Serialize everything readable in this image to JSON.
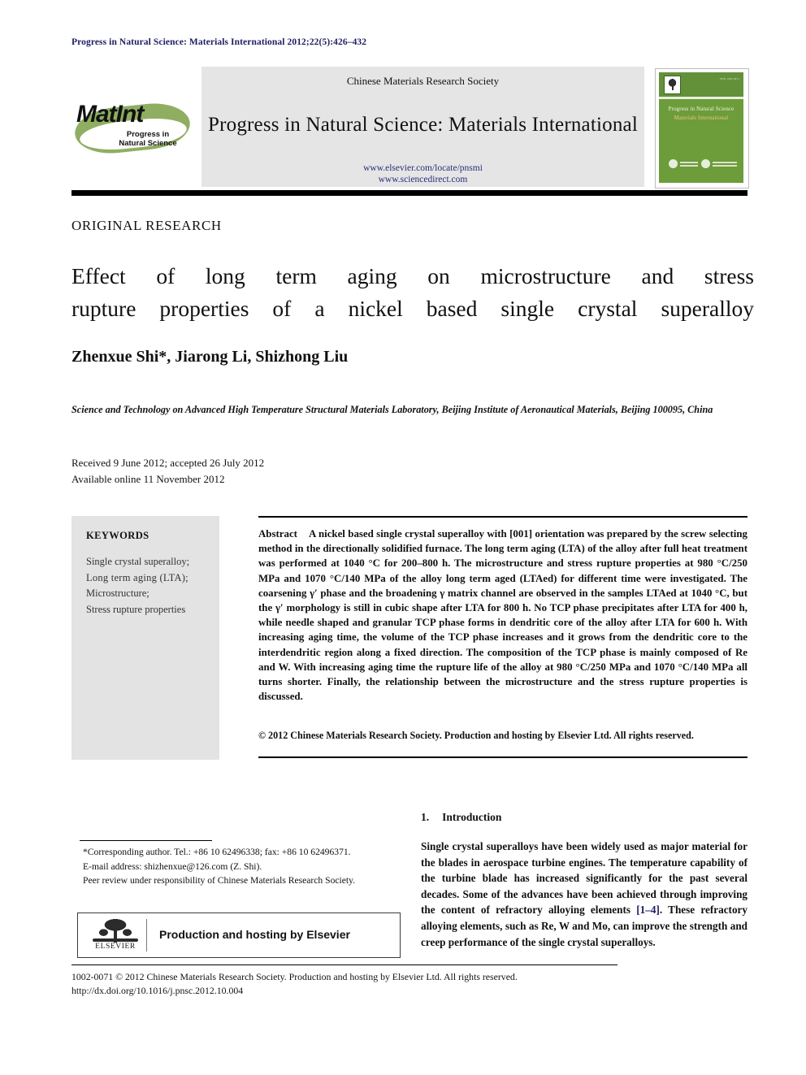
{
  "running_head": "Progress in Natural Science: Materials International 2012;22(5):426–432",
  "masthead": {
    "society": "Chinese Materials Research Society",
    "journal_title": "Progress in Natural Science: Materials International",
    "url_primary": "www.elsevier.com/locate/pnsmi",
    "url_secondary": "www.sciencedirect.com",
    "logo_wordmark": "MatInt",
    "logo_sub_line1": "Progress in",
    "logo_sub_line2": "Natural Science",
    "cover": {
      "issn": "ISSN 1002-0071",
      "title_line1": "Progress in Natural Science",
      "title_line2": "Materials International"
    }
  },
  "article_type": "ORIGINAL RESEARCH",
  "title_line1": "Effect of long term aging on microstructure and stress",
  "title_line2": "rupture properties of a nickel based single crystal superalloy",
  "authors": "Zhenxue Shi*, Jiarong Li, Shizhong Liu",
  "authors_plain": "Zhenxue Shi",
  "authors_rest": ", Jiarong Li, Shizhong Liu",
  "affiliation": "Science and Technology on Advanced High Temperature Structural Materials Laboratory, Beijing Institute of Aeronautical Materials, Beijing 100095, China",
  "dates": {
    "received": "Received 9 June 2012; accepted 26 July 2012",
    "available": "Available online 11 November 2012"
  },
  "keywords": {
    "heading": "KEYWORDS",
    "items": [
      "Single crystal superalloy;",
      "Long term aging (LTA);",
      "Microstructure;",
      "Stress rupture properties"
    ]
  },
  "abstract": {
    "label": "Abstract",
    "text": "A nickel based single crystal superalloy with [001] orientation was prepared by the screw selecting method in the directionally solidified furnace. The long term aging (LTA) of the alloy after full heat treatment was performed at 1040 °C for 200–800 h. The microstructure and stress rupture properties at 980 °C/250 MPa and 1070 °C/140 MPa of the alloy long term aged (LTAed) for different time were investigated. The coarsening γ′ phase and the broadening γ matrix channel are observed in the samples LTAed at 1040 °C, but the γ′ morphology is still in cubic shape after LTA for 800 h. No TCP phase precipitates after LTA for 400 h, while needle shaped and granular TCP phase forms in dendritic core of the alloy after LTA for 600 h. With increasing aging time, the volume of the TCP phase increases and it grows from the dendritic core to the interdendritic region along a fixed direction. The composition of the TCP phase is mainly composed of Re and W. With increasing aging time the rupture life of the alloy at 980 °C/250 MPa and 1070 °C/140 MPa all turns shorter. Finally, the relationship between the microstructure and the stress rupture properties is discussed.",
    "copyright": "© 2012 Chinese Materials Research Society. Production and hosting by Elsevier Ltd. All rights reserved."
  },
  "footnotes": {
    "corresponding": "*Corresponding author. Tel.: +86 10 62496338; fax: +86 10 62496371.",
    "email": "E-mail address: shizhenxue@126.com (Z. Shi).",
    "peer_review": "Peer review under responsibility of Chinese Materials Research Society."
  },
  "production_box": {
    "logo_name": "ELSEVIER",
    "text": "Production and hosting by Elsevier"
  },
  "introduction": {
    "number": "1.",
    "heading": "Introduction",
    "para_part1": "Single crystal superalloys have been widely used as major material for the blades in aerospace turbine engines. The temperature capability of the turbine blade has increased significantly for the past several decades. Some of the advances have been achieved through improving the content of refractory alloying elements ",
    "reference": "[1–4]",
    "para_part2": ". These refractory alloying elements, such as Re, W and Mo, can improve the strength and creep performance of the single crystal superalloys."
  },
  "page_footer": {
    "line1": "1002-0071 © 2012 Chinese Materials Research Society. Production and hosting by Elsevier Ltd. All rights reserved.",
    "doi": "http://dx.doi.org/10.1016/j.pnsc.2012.10.004"
  },
  "colors": {
    "running_head": "#1d1d63",
    "link": "#2b2b7a",
    "keywords_bg": "#e3e3e3",
    "masthead_bg": "#e5e5e5",
    "cover_green": "#6d9c3a",
    "logo_green": "#8fae62"
  }
}
